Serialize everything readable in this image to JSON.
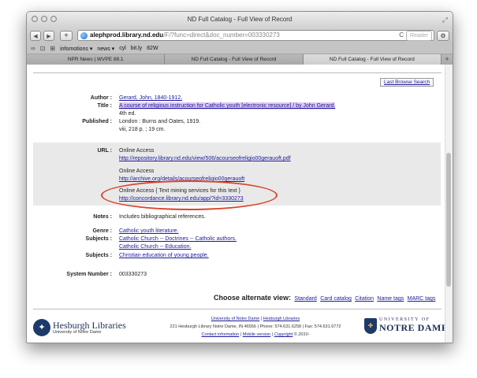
{
  "window": {
    "title": "ND Full Catalog - Full View of Record"
  },
  "toolbar": {
    "back": "◀",
    "forward": "▶",
    "add": "+",
    "url_host": "alephprod.library.nd.edu",
    "url_path": "/F/?func=direct&doc_number=003330273",
    "reload": "C",
    "reader": "Reader",
    "settings": "⚙"
  },
  "bookmarks": [
    "infomotions ▾",
    "news ▾",
    "cyl",
    "bit.ly",
    "82W"
  ],
  "tabs": [
    {
      "label": "NPR News | WVPE 88.1",
      "active": false
    },
    {
      "label": "ND Full Catalog - Full View of Record",
      "active": false
    },
    {
      "label": "ND Full Catalog - Full View of Record",
      "active": true
    }
  ],
  "last_browse": "Last Browse Search",
  "record": {
    "author_label": "Author :",
    "author": "Gerard, John, 1840-1912.",
    "title_label": "Title :",
    "title": "A course of religious instruction for Catholic youth [electronic resource] / by John Gerard.",
    "edition": "4th ed.",
    "published_label": "Published :",
    "published": "London : Burns and Oates, 1919.",
    "description": "viii, 218 p. ; 19 cm.",
    "url_label": "URL :",
    "urls": [
      {
        "label": "Online Access",
        "link": "http://repository.library.nd.edu/view/506/acourseofreligio00gerauoft.pdf"
      },
      {
        "label": "Online Access",
        "link": "http://archive.org/details/acourseofreligio00gerauoft"
      },
      {
        "label": "Online Access { Text mining services for this text }",
        "link": "http://concordance.library.nd.edu/app/?id=3330273"
      }
    ],
    "notes_label": "Notes :",
    "notes": "Includes bibliographical references.",
    "genre_label": "Genre :",
    "genre": "Catholic youth literature.",
    "subjects_label": "Subjects :",
    "subjects1": [
      "Catholic Church -- Doctrines -- Catholic authors.",
      "Catholic Church -- Education."
    ],
    "subjects2_label": "Subjects :",
    "subjects2": "Christian education of young people.",
    "sysnum_label": "System Number :",
    "sysnum": "003330273"
  },
  "alt_view": {
    "label": "Choose alternate view:",
    "options": [
      "Standard",
      "Card catalog",
      "Citation",
      "Name tags",
      "MARC tags"
    ]
  },
  "footer": {
    "hesburgh_name": "Hesburgh Libraries",
    "hesburgh_sub": "University of Notre Dame",
    "line1a": "University of Notre Dame",
    "line1sep": " | ",
    "line1b": "Hesburgh Libraries",
    "line2": "221 Hesburgh Library Notre Dame, IN 46556 | Phone: 574.631.6258 | Fax: 574.631.6772",
    "line3a": "Contact information",
    "line3sep": " | ",
    "line3b": "Mobile version",
    "line3c": " | ",
    "line3d": "Copyright",
    "line3e": " © 2010-",
    "nd_univ": "UNIVERSITY OF",
    "nd_name": "NOTRE DAME"
  }
}
